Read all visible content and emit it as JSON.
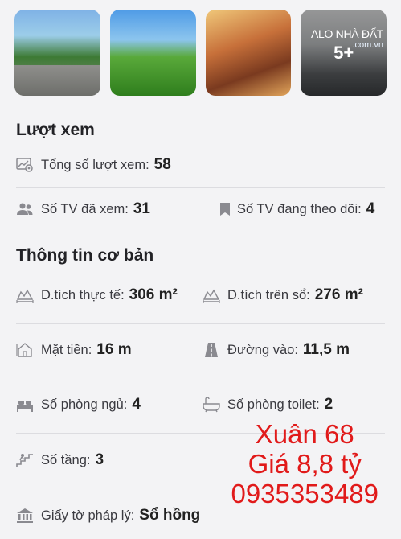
{
  "gallery": {
    "more_count": "5+",
    "watermark_brand": "ALO NHÀ ĐẤT",
    "watermark_domain": ".com.vn"
  },
  "views_section": {
    "title": "Lượt xem",
    "total_views_label": "Tổng số lượt xem:",
    "total_views_value": "58",
    "members_viewed_label": "Số TV đã xem:",
    "members_viewed_value": "31",
    "members_following_label": "Số TV đang theo dõi:",
    "members_following_value": "4"
  },
  "basic_info": {
    "title": "Thông tin cơ bản",
    "actual_area_label": "D.tích thực tế:",
    "actual_area_value": "306 m²",
    "book_area_label": "D.tích trên sổ:",
    "book_area_value": "276 m²",
    "frontage_label": "Mặt tiền:",
    "frontage_value": "16 m",
    "access_road_label": "Đường vào:",
    "access_road_value": "11,5 m",
    "bedrooms_label": "Số phòng ngủ:",
    "bedrooms_value": "4",
    "toilets_label": "Số phòng toilet:",
    "toilets_value": "2",
    "floors_label": "Số tầng:",
    "floors_value": "3",
    "legal_label": "Giấy tờ pháp lý:",
    "legal_value": "Sổ hồng"
  },
  "promo_overlay": {
    "line1": "Xuân 68",
    "line2": "Giá 8,8 tỷ",
    "line3": "0935353489"
  },
  "colors": {
    "promo_text": "#e11a1a",
    "background": "#f3f3f5",
    "icon_gray": "#8a8a90"
  }
}
